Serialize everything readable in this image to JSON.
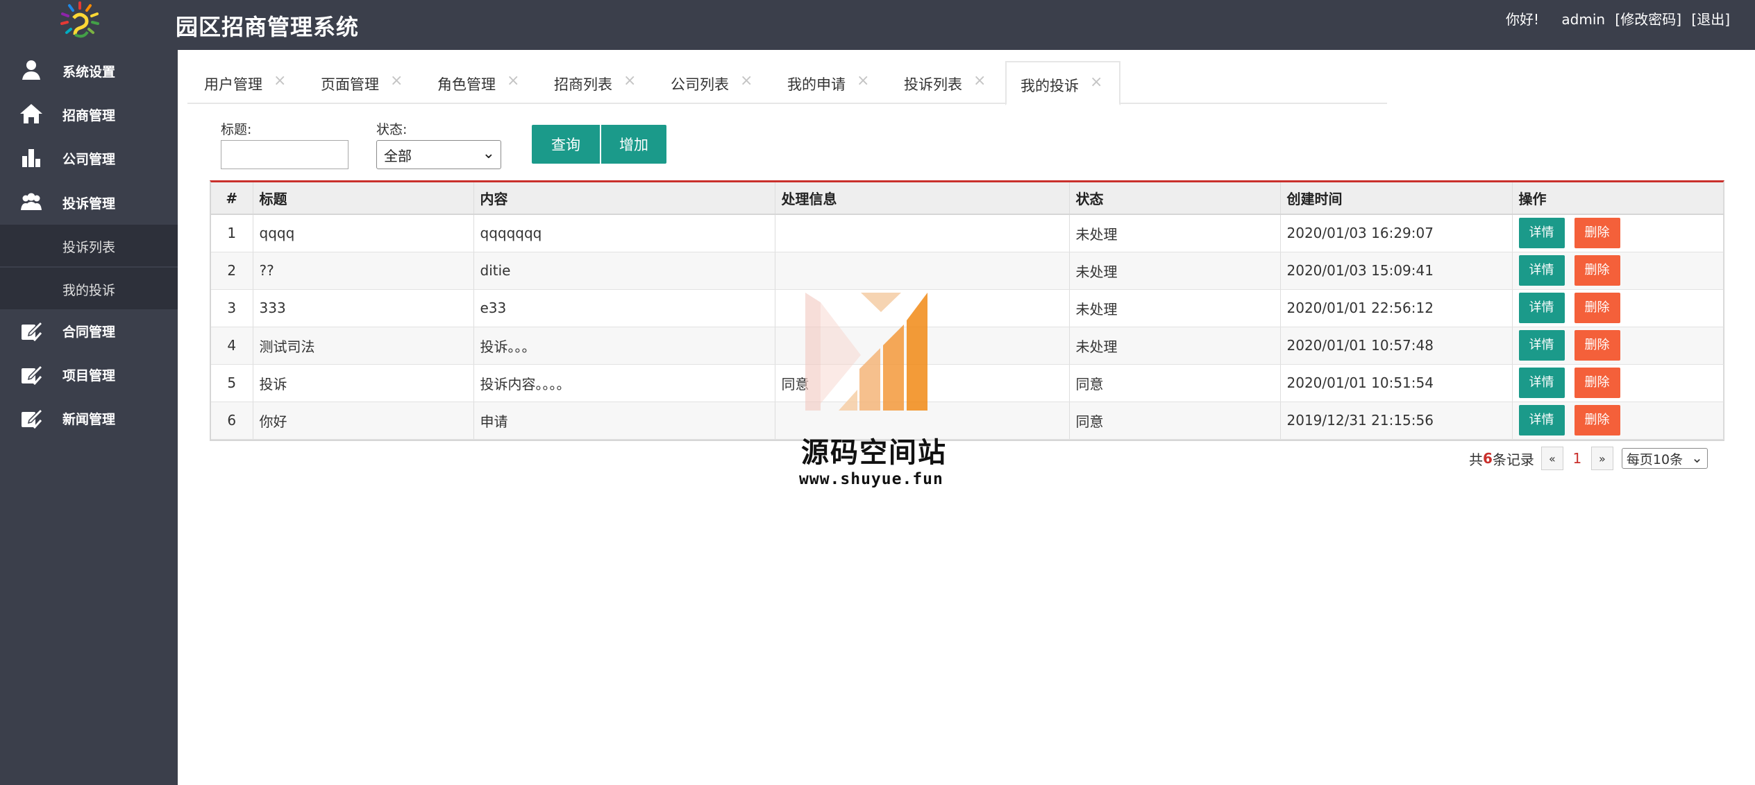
{
  "app": {
    "title": "园区招商管理系统"
  },
  "user": {
    "greeting": "你好!",
    "name": "admin",
    "change_password": "[修改密码]",
    "logout": "[退出]"
  },
  "sidebar": {
    "items": [
      {
        "label": "系统设置",
        "icon": "user-icon"
      },
      {
        "label": "招商管理",
        "icon": "home-icon"
      },
      {
        "label": "公司管理",
        "icon": "building-icon"
      },
      {
        "label": "投诉管理",
        "icon": "group-icon"
      },
      {
        "label": "合同管理",
        "icon": "edit-check-icon"
      },
      {
        "label": "项目管理",
        "icon": "edit-check-icon"
      },
      {
        "label": "新闻管理",
        "icon": "edit-check-icon"
      }
    ],
    "subitems": [
      {
        "label": "投诉列表"
      },
      {
        "label": "我的投诉"
      }
    ]
  },
  "tabs": [
    {
      "label": "用户管理"
    },
    {
      "label": "页面管理"
    },
    {
      "label": "角色管理"
    },
    {
      "label": "招商列表"
    },
    {
      "label": "公司列表"
    },
    {
      "label": "我的申请"
    },
    {
      "label": "投诉列表"
    },
    {
      "label": "我的投诉",
      "active": true
    }
  ],
  "search": {
    "title_label": "标题:",
    "title_value": "",
    "status_label": "状态:",
    "status_value": "全部",
    "query_label": "查询",
    "add_label": "增加"
  },
  "table": {
    "headers": [
      "#",
      "标题",
      "内容",
      "处理信息",
      "状态",
      "创建时间",
      "操作"
    ],
    "rows": [
      {
        "num": "1",
        "title": "qqqq",
        "content": "qqqqqqq",
        "info": "",
        "status": "未处理",
        "status_type": "pending",
        "created": "2020/01/03 16:29:07"
      },
      {
        "num": "2",
        "title": "??",
        "content": "ditie",
        "info": "",
        "status": "未处理",
        "status_type": "pending",
        "created": "2020/01/03 15:09:41"
      },
      {
        "num": "3",
        "title": "333",
        "content": "e33",
        "info": "",
        "status": "未处理",
        "status_type": "pending",
        "created": "2020/01/01 22:56:12"
      },
      {
        "num": "4",
        "title": "测试司法",
        "content": "投诉。。。",
        "info": "",
        "status": "未处理",
        "status_type": "pending",
        "created": "2020/01/01 10:57:48"
      },
      {
        "num": "5",
        "title": "投诉",
        "content": "投诉内容。。。。",
        "info": "同意",
        "status": "同意",
        "status_type": "agree",
        "created": "2020/01/01 10:51:54"
      },
      {
        "num": "6",
        "title": "你好",
        "content": "申请",
        "info": "",
        "status": "同意",
        "status_type": "agree",
        "created": "2019/12/31 21:15:56"
      }
    ],
    "detail_label": "详情",
    "delete_label": "删除"
  },
  "pager": {
    "prefix": "共",
    "total": "6",
    "suffix": "条记录",
    "prev": "«",
    "current": "1",
    "next": "»",
    "page_size": "每页10条"
  },
  "watermark": {
    "title": "源码空间站",
    "url": "www.shuyue.fun"
  },
  "colors": {
    "sidebar": "#3b3f4b",
    "primary": "#1b9a8a",
    "danger": "#f4603a",
    "accent_red": "#c9302c",
    "pending": "#d69a1c",
    "agree": "#2e8b2e"
  }
}
